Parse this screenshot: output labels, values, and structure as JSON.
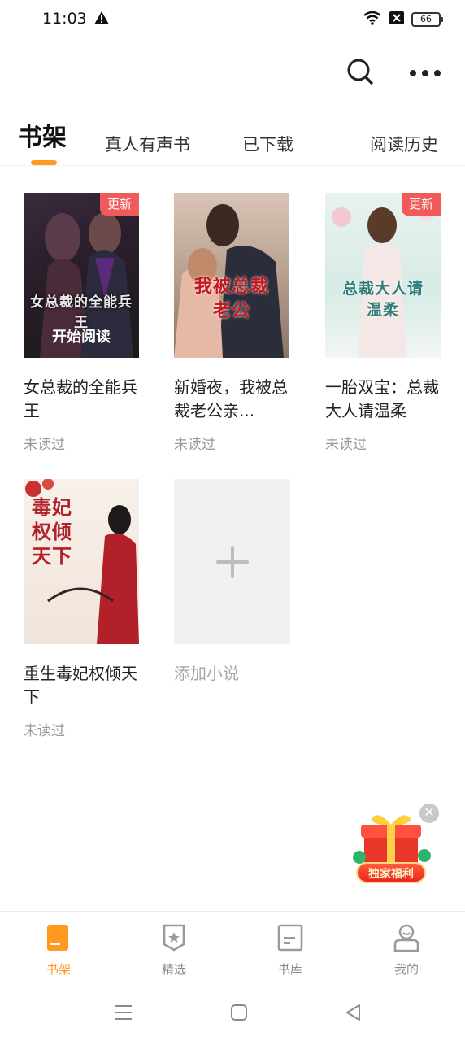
{
  "status_bar": {
    "time": "11:03",
    "battery": "66"
  },
  "header": {
    "search_icon": "search-icon",
    "more_icon": "more-icon"
  },
  "tabs": [
    {
      "label": "书架",
      "active": true
    },
    {
      "label": "真人有声书"
    },
    {
      "label": "已下载"
    },
    {
      "label": "阅读历史"
    }
  ],
  "books": [
    {
      "title": "女总裁的全能兵王",
      "status": "未读过",
      "badge": "更新",
      "cover_text": "女总裁的全能兵王",
      "cover_action": "开始阅读"
    },
    {
      "title": "新婚夜，我被总裁老公亲...",
      "status": "未读过",
      "cover_text": "我被总裁老公"
    },
    {
      "title": "一胎双宝：总裁大人请温柔",
      "status": "未读过",
      "badge": "更新",
      "cover_text": "总裁大人请温柔"
    },
    {
      "title": "重生毒妃权倾天下",
      "status": "未读过",
      "cover_text": "毒妃权倾天下"
    }
  ],
  "add_novel": {
    "label": "添加小说"
  },
  "promo": {
    "label": "独家福利"
  },
  "bottom_nav": [
    {
      "label": "书架",
      "icon": "bookshelf-icon",
      "active": true
    },
    {
      "label": "精选",
      "icon": "featured-icon"
    },
    {
      "label": "书库",
      "icon": "library-icon"
    },
    {
      "label": "我的",
      "icon": "profile-icon"
    }
  ],
  "colors": {
    "accent": "#ff9a1e",
    "badge": "#f05a5a",
    "muted": "#9a9a9a"
  }
}
